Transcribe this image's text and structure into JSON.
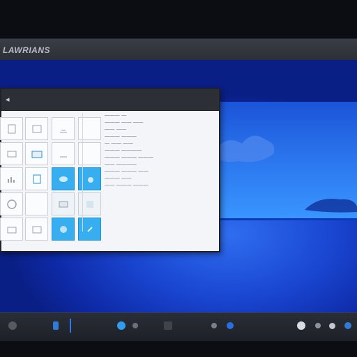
{
  "app": {
    "title": "LAWRIANS"
  },
  "window": {
    "list_items": [
      "———  —",
      "——— —— ——",
      "—— ——",
      "——— ———",
      "— —— ——",
      "——— ————",
      "——— ——— ———",
      "—— ————",
      "——— ——— ——",
      "——— ——",
      "—— ——— ———"
    ]
  },
  "colors": {
    "desktop": "#1a47d2",
    "tile_accent": "#36aef0",
    "taskbar": "#1d2027"
  },
  "taskbar": {
    "icons": [
      "settings-icon",
      "blue-app-icon",
      "start-icon",
      "circle-app-icon",
      "grid-app-icon",
      "gear-app-icon",
      "record-icon",
      "search-icon",
      "globe-icon",
      "user-icon"
    ]
  }
}
